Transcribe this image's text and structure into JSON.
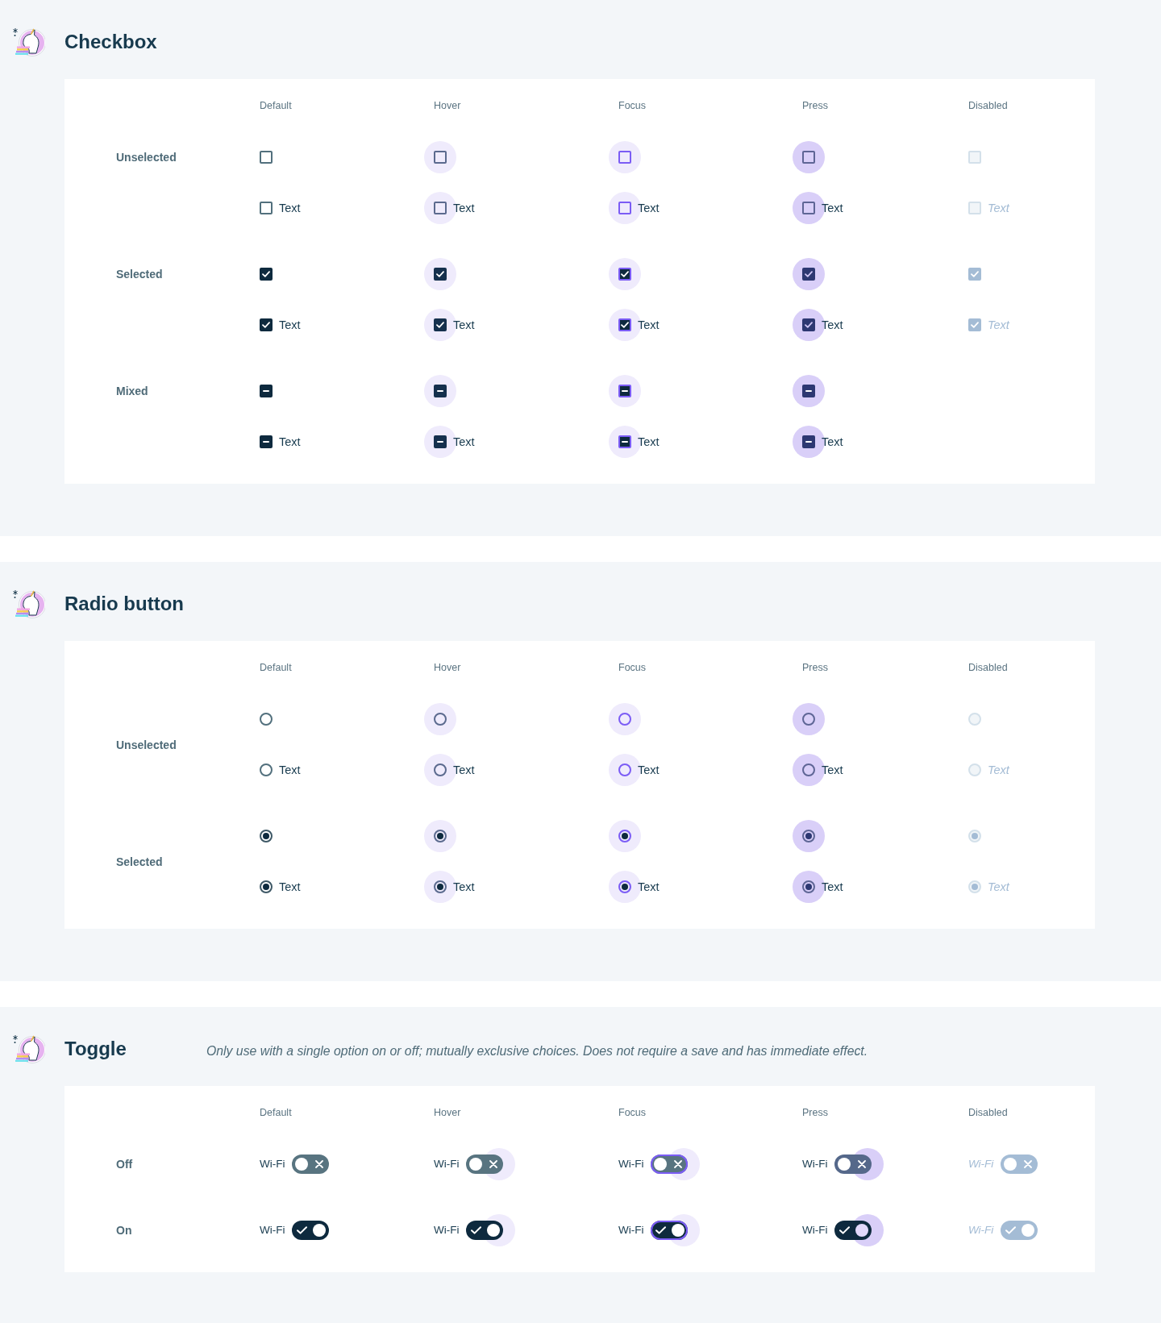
{
  "sections": [
    {
      "kind": "checkbox",
      "title": "Checkbox",
      "columns": [
        "Default",
        "Hover",
        "Focus",
        "Press",
        "Disabled"
      ],
      "groups": [
        {
          "label": "Unselected",
          "rows": [
            {
              "cells": [
                {
                  "kind": "default",
                  "checked": false
                },
                {
                  "kind": "hover",
                  "checked": false
                },
                {
                  "kind": "focus",
                  "checked": false
                },
                {
                  "kind": "press",
                  "checked": false
                },
                {
                  "kind": "disabled",
                  "checked": false
                }
              ]
            },
            {
              "cells": [
                {
                  "kind": "default",
                  "checked": false,
                  "label": "Text"
                },
                {
                  "kind": "hover",
                  "checked": false,
                  "label": "Text"
                },
                {
                  "kind": "focus",
                  "checked": false,
                  "label": "Text"
                },
                {
                  "kind": "press",
                  "checked": false,
                  "label": "Text"
                },
                {
                  "kind": "disabled",
                  "checked": false,
                  "label": "Text"
                }
              ]
            }
          ]
        },
        {
          "label": "Selected",
          "rows": [
            {
              "cells": [
                {
                  "kind": "default",
                  "checked": true
                },
                {
                  "kind": "hover",
                  "checked": true
                },
                {
                  "kind": "focus",
                  "checked": true
                },
                {
                  "kind": "press",
                  "checked": true
                },
                {
                  "kind": "disabled",
                  "checked": true
                }
              ]
            },
            {
              "cells": [
                {
                  "kind": "default",
                  "checked": true,
                  "label": "Text"
                },
                {
                  "kind": "hover",
                  "checked": true,
                  "label": "Text"
                },
                {
                  "kind": "focus",
                  "checked": true,
                  "label": "Text"
                },
                {
                  "kind": "press",
                  "checked": true,
                  "label": "Text"
                },
                {
                  "kind": "disabled",
                  "checked": true,
                  "label": "Text"
                }
              ]
            }
          ]
        },
        {
          "label": "Mixed",
          "rows": [
            {
              "cells": [
                {
                  "kind": "default",
                  "mixed": true
                },
                {
                  "kind": "hover",
                  "mixed": true
                },
                {
                  "kind": "focus",
                  "mixed": true
                },
                {
                  "kind": "press",
                  "mixed": true
                }
              ]
            },
            {
              "cells": [
                {
                  "kind": "default",
                  "mixed": true,
                  "label": "Text"
                },
                {
                  "kind": "hover",
                  "mixed": true,
                  "label": "Text"
                },
                {
                  "kind": "focus",
                  "mixed": true,
                  "label": "Text"
                },
                {
                  "kind": "press",
                  "mixed": true,
                  "label": "Text"
                }
              ]
            }
          ]
        }
      ]
    },
    {
      "kind": "radio",
      "title": "Radio button",
      "columns": [
        "Default",
        "Hover",
        "Focus",
        "Press",
        "Disabled"
      ],
      "groups": [
        {
          "label": "Unselected",
          "rows": [
            {
              "cells": [
                {
                  "kind": "default",
                  "selected": false
                },
                {
                  "kind": "hover",
                  "selected": false
                },
                {
                  "kind": "focus",
                  "selected": false
                },
                {
                  "kind": "press",
                  "selected": false
                },
                {
                  "kind": "disabled",
                  "selected": false
                }
              ]
            },
            {
              "cells": [
                {
                  "kind": "default",
                  "selected": false,
                  "label": "Text"
                },
                {
                  "kind": "hover",
                  "selected": false,
                  "label": "Text"
                },
                {
                  "kind": "focus",
                  "selected": false,
                  "label": "Text"
                },
                {
                  "kind": "press",
                  "selected": false,
                  "label": "Text"
                },
                {
                  "kind": "disabled",
                  "selected": false,
                  "label": "Text"
                }
              ]
            }
          ]
        },
        {
          "label": "Selected",
          "rows": [
            {
              "cells": [
                {
                  "kind": "default",
                  "selected": true
                },
                {
                  "kind": "hover",
                  "selected": true
                },
                {
                  "kind": "focus",
                  "selected": true
                },
                {
                  "kind": "press",
                  "selected": true
                },
                {
                  "kind": "disabled",
                  "selected": true
                }
              ]
            },
            {
              "cells": [
                {
                  "kind": "default",
                  "selected": true,
                  "label": "Text"
                },
                {
                  "kind": "hover",
                  "selected": true,
                  "label": "Text"
                },
                {
                  "kind": "focus",
                  "selected": true,
                  "label": "Text"
                },
                {
                  "kind": "press",
                  "selected": true,
                  "label": "Text"
                },
                {
                  "kind": "disabled",
                  "selected": true,
                  "label": "Text"
                }
              ]
            }
          ]
        }
      ]
    },
    {
      "kind": "toggle",
      "title": "Toggle",
      "description": "Only use with a single option on or off; mutually exclusive choices. Does not require a save and has immediate effect.",
      "columns": [
        "Default",
        "Hover",
        "Focus",
        "Press",
        "Disabled"
      ],
      "groups": [
        {
          "label": "Off",
          "rows": [
            {
              "cells": [
                {
                  "kind": "default",
                  "on": false,
                  "label": "Wi-Fi"
                },
                {
                  "kind": "hover",
                  "on": false,
                  "label": "Wi-Fi"
                },
                {
                  "kind": "focus",
                  "on": false,
                  "label": "Wi-Fi"
                },
                {
                  "kind": "press",
                  "on": false,
                  "label": "Wi-Fi"
                },
                {
                  "kind": "disabled",
                  "on": false,
                  "label": "Wi-Fi"
                }
              ]
            }
          ]
        },
        {
          "label": "On",
          "rows": [
            {
              "cells": [
                {
                  "kind": "default",
                  "on": true,
                  "label": "Wi-Fi"
                },
                {
                  "kind": "hover",
                  "on": true,
                  "label": "Wi-Fi"
                },
                {
                  "kind": "focus",
                  "on": true,
                  "label": "Wi-Fi"
                },
                {
                  "kind": "press",
                  "on": true,
                  "label": "Wi-Fi"
                },
                {
                  "kind": "disabled",
                  "on": true,
                  "label": "Wi-Fi"
                }
              ]
            }
          ]
        }
      ]
    }
  ]
}
